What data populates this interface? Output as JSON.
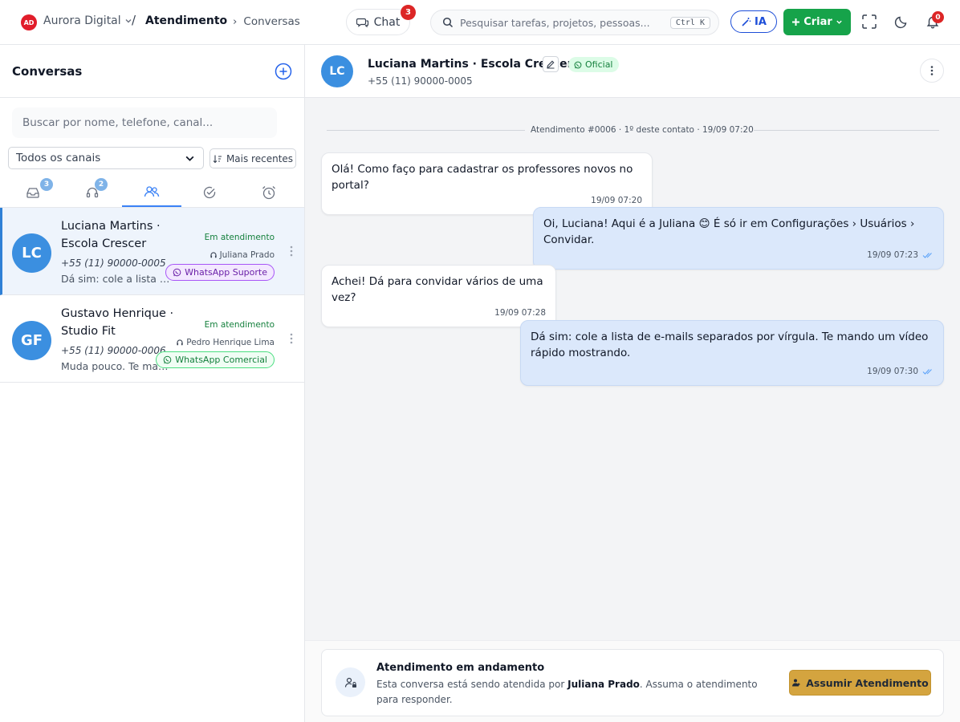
{
  "topbar": {
    "logo_text": "AD",
    "org_name": "Aurora Digital",
    "breadcrumb_sep": "/",
    "breadcrumb_main": "Atendimento",
    "breadcrumb_arrow": "›",
    "breadcrumb_sub": "Conversas",
    "chat_label": "Chat",
    "chat_badge": "3",
    "search_placeholder": "Pesquisar tarefas, projetos, pessoas...",
    "search_shortcut": "Ctrl K",
    "ia_label": "IA",
    "criar_label": "Criar",
    "notif_badge": "0"
  },
  "sidebar": {
    "title": "Conversas",
    "search_placeholder": "Buscar por nome, telefone, canal...",
    "channel_filter": "Todos os canais",
    "sort_label": "Mais recentes",
    "tabs": [
      {
        "icon": "inbox-icon",
        "badge": "3"
      },
      {
        "icon": "headset-icon",
        "badge": "2"
      },
      {
        "icon": "users-icon",
        "badge": ""
      },
      {
        "icon": "check-circle-icon",
        "badge": ""
      },
      {
        "icon": "alarm-clock-icon",
        "badge": ""
      }
    ],
    "conversations": [
      {
        "initials": "LC",
        "name": "Luciana Martins · Escola Crescer",
        "phone": "+55 (11) 90000-0005",
        "preview": "Dá sim: cole a lista de e-mails separados por vírgula.",
        "status": "Em atendimento",
        "agent": "Juliana Prado",
        "channel": "WhatsApp Suporte"
      },
      {
        "initials": "GF",
        "name": "Gustavo Henrique · Studio Fit",
        "phone": "+55 (11) 90000-0006",
        "preview": "Muda pouco. Te mando o link.",
        "status": "Em atendimento",
        "agent": "Pedro Henrique Lima",
        "channel": "WhatsApp Comercial"
      }
    ]
  },
  "chat": {
    "initials": "LC",
    "name": "Luciana Martins · Escola Crescer",
    "badge": "Oficial",
    "phone": "+55 (11) 90000-0005",
    "separator": "Atendimento #0006 · 1º deste contato · 19/09 07:20",
    "messages": [
      {
        "text": "Olá! Como faço para cadastrar os professores novos no portal?",
        "time": "19/09 07:20"
      },
      {
        "text": "Oi, Luciana! Aqui é a Juliana 😊 É só ir em Configurações › Usuários › Convidar.",
        "time": "19/09 07:23"
      },
      {
        "text": "Achei! Dá para convidar vários de uma vez?",
        "time": "19/09 07:28"
      },
      {
        "text": "Dá sim: cole a lista de e-mails separados por vírgula. Te mando um vídeo rápido mostrando.",
        "time": "19/09 07:30"
      }
    ],
    "notice_title": "Atendimento em andamento",
    "notice_pre": "Esta conversa está sendo atendida por ",
    "notice_agent": "Juliana Prado",
    "notice_post": ". Assuma o atendimento para responder.",
    "assumir_label": "Assumir Atendimento"
  },
  "colors": {
    "primary": "#3b82f6",
    "create": "#16a34a",
    "danger": "#dc2626",
    "assumir": "#d4a43f",
    "outgoing_bubble": "#dbe8fb"
  }
}
